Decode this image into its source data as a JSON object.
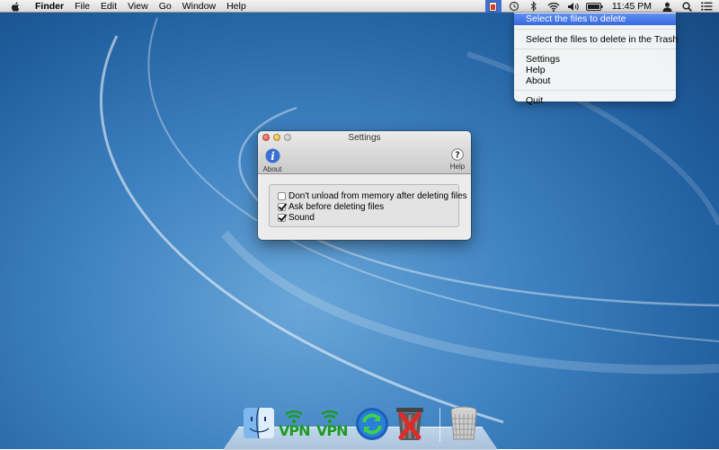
{
  "menubar": {
    "apple_icon": "apple-icon",
    "items": [
      {
        "label": "Finder",
        "bold": true
      },
      {
        "label": "File"
      },
      {
        "label": "Edit"
      },
      {
        "label": "View"
      },
      {
        "label": "Go"
      },
      {
        "label": "Window"
      },
      {
        "label": "Help"
      }
    ],
    "status_icons": [
      "file-deleter-app-icon",
      "time-machine-icon",
      "bluetooth-icon",
      "wifi-icon",
      "volume-icon",
      "battery-icon"
    ],
    "clock": "11:45 PM",
    "right_icons": [
      "user-icon",
      "spotlight-icon",
      "notification-list-icon"
    ]
  },
  "dropdown": {
    "items": [
      {
        "label": "Select the files to delete",
        "highlighted": true
      },
      {
        "label": "Select the files to delete in the Trash"
      },
      {
        "label": "Settings"
      },
      {
        "label": "Help"
      },
      {
        "label": "About"
      },
      {
        "label": "Quit"
      }
    ]
  },
  "settings_window": {
    "title": "Settings",
    "toolbar": {
      "about_label": "About",
      "help_label": "Help",
      "about_glyph": "i",
      "help_glyph": "?"
    },
    "options": [
      {
        "label": "Don't unload from memory after deleting files",
        "checked": false
      },
      {
        "label": "Ask before deleting files",
        "checked": true
      },
      {
        "label": "Sound",
        "checked": true
      }
    ]
  },
  "dock": {
    "items": [
      "finder-icon",
      "vpn-icon",
      "vpn-icon",
      "sync-icon",
      "delete-trash-icon",
      "trash-icon"
    ],
    "vpn_label": "VPN"
  },
  "colors": {
    "menu_highlight": "#3769e0",
    "vpn_green": "#1e9a22",
    "sync_blue": "#1c5fb8"
  }
}
